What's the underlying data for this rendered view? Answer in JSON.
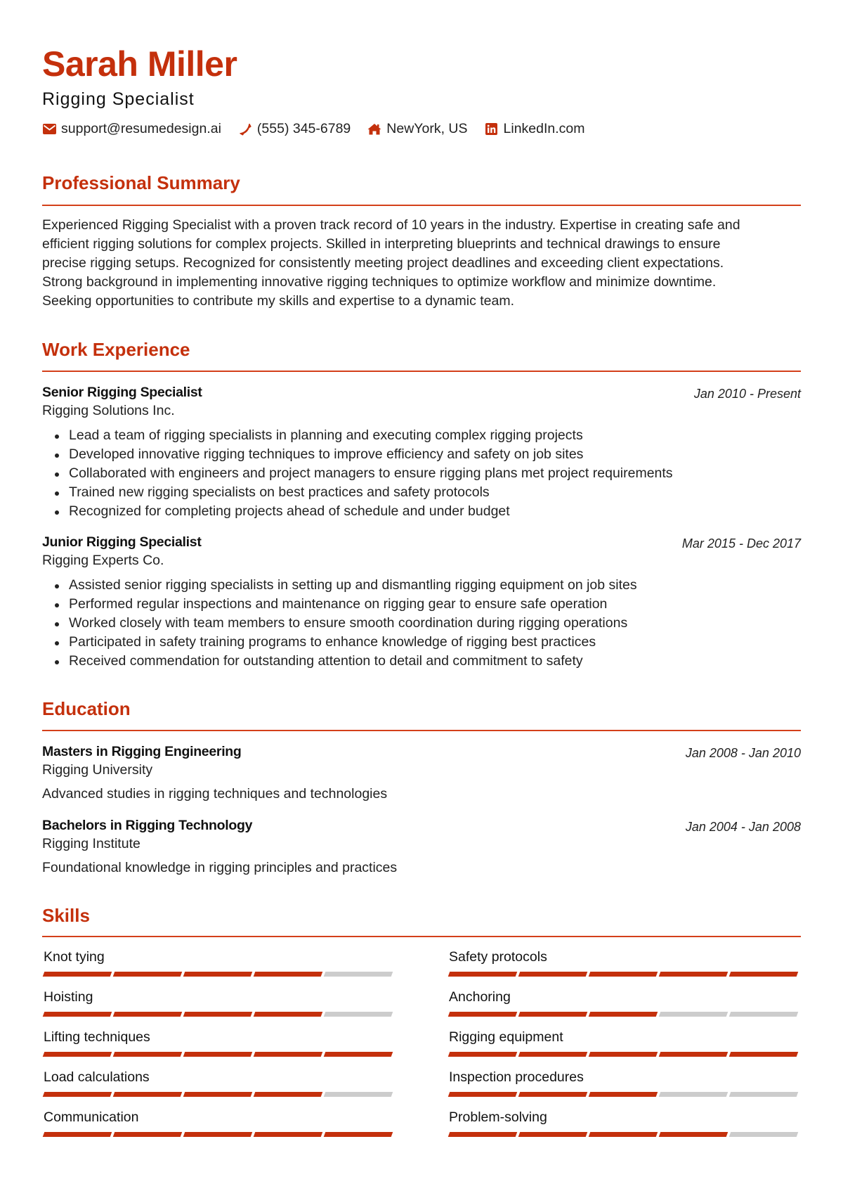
{
  "header": {
    "name": "Sarah Miller",
    "title": "Rigging Specialist",
    "contacts": [
      {
        "icon": "envelope-icon",
        "text": "support@resumedesign.ai"
      },
      {
        "icon": "phone-icon",
        "text": "(555) 345-6789"
      },
      {
        "icon": "home-icon",
        "text": "NewYork, US"
      },
      {
        "icon": "linkedin-icon",
        "text": "LinkedIn.com"
      }
    ]
  },
  "colors": {
    "accent": "#c4300c",
    "rule": "#d4401a",
    "inactive": "#cccccc",
    "text": "#222222"
  },
  "summary": {
    "heading": "Professional Summary",
    "lines": [
      "Experienced Rigging Specialist with a proven track record of 10 years in the industry. Expertise in creating safe and",
      "efficient rigging solutions for complex projects. Skilled in interpreting blueprints and technical drawings to ensure",
      "precise rigging setups. Recognized for consistently meeting project deadlines and exceeding client expectations.",
      "Strong background in implementing innovative rigging techniques to optimize workflow and minimize downtime.",
      "Seeking opportunities to contribute my skills and expertise to a dynamic team."
    ]
  },
  "experience": {
    "heading": "Work Experience",
    "jobs": [
      {
        "title": "Senior Rigging Specialist",
        "company": "Rigging Solutions Inc.",
        "dates": "Jan 2010 - Present",
        "bullets": [
          "Lead a team of rigging specialists in planning and executing complex rigging projects",
          "Developed innovative rigging techniques to improve efficiency and safety on job sites",
          "Collaborated with engineers and project managers to ensure rigging plans met project requirements",
          "Trained new rigging specialists on best practices and safety protocols",
          "Recognized for completing projects ahead of schedule and under budget"
        ]
      },
      {
        "title": "Junior Rigging Specialist",
        "company": "Rigging Experts Co.",
        "dates": "Mar 2015 - Dec 2017",
        "bullets": [
          "Assisted senior rigging specialists in setting up and dismantling rigging equipment on job sites",
          "Performed regular inspections and maintenance on rigging gear to ensure safe operation",
          "Worked closely with team members to ensure smooth coordination during rigging operations",
          "Participated in safety training programs to enhance knowledge of rigging best practices",
          "Received commendation for outstanding attention to detail and commitment to safety"
        ]
      }
    ]
  },
  "education": {
    "heading": "Education",
    "items": [
      {
        "degree": "Masters in Rigging Engineering",
        "school": "Rigging University",
        "dates": "Jan 2008 - Jan 2010",
        "description": "Advanced studies in rigging techniques and technologies"
      },
      {
        "degree": "Bachelors in Rigging Technology",
        "school": "Rigging Institute",
        "dates": "Jan 2004 - Jan 2008",
        "description": "Foundational knowledge in rigging principles and practices"
      }
    ]
  },
  "skills": {
    "heading": "Skills",
    "max_level": 5,
    "items": [
      {
        "name": "Knot tying",
        "level": 4
      },
      {
        "name": "Safety protocols",
        "level": 5
      },
      {
        "name": "Hoisting",
        "level": 4
      },
      {
        "name": "Anchoring",
        "level": 3
      },
      {
        "name": "Lifting techniques",
        "level": 5
      },
      {
        "name": "Rigging equipment",
        "level": 5
      },
      {
        "name": "Load calculations",
        "level": 4
      },
      {
        "name": "Inspection procedures",
        "level": 3
      },
      {
        "name": "Communication",
        "level": 5
      },
      {
        "name": "Problem-solving",
        "level": 4
      }
    ]
  }
}
